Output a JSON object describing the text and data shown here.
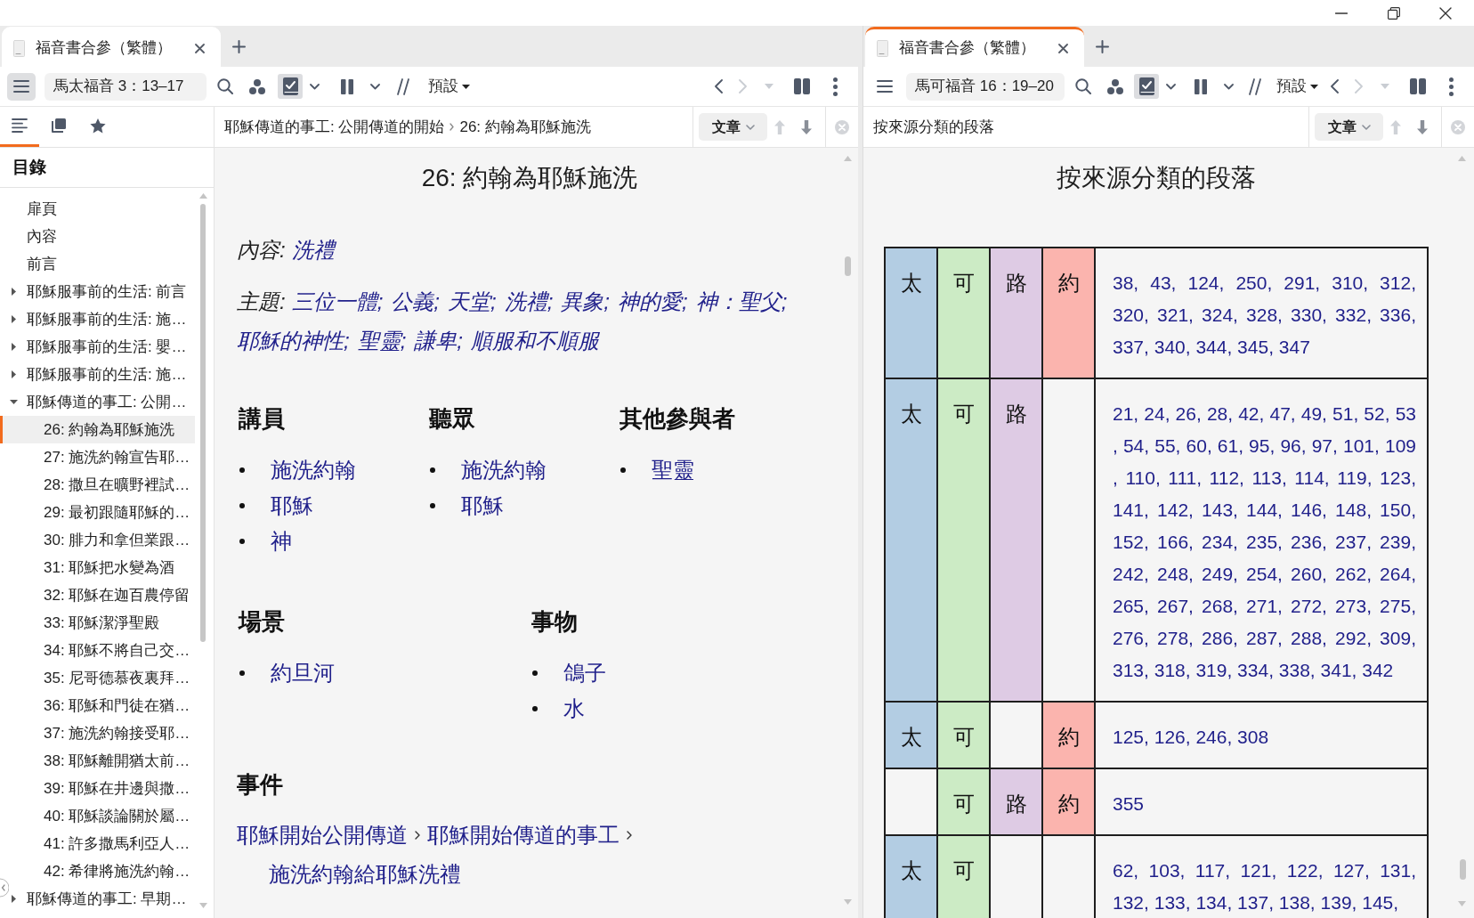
{
  "left_pane": {
    "focused": false,
    "tabs": [
      {
        "label": "福音書合參（繁體）",
        "selected": true
      }
    ],
    "toolbar": {
      "menu_pressed": true,
      "reference": "馬太福音 3：13–17",
      "markers_on": true,
      "preset": "預設",
      "back_disabled": false,
      "forward_disabled": true,
      "history_disabled": true
    },
    "sidebar": {
      "tabs": [
        {
          "selected": true
        },
        {
          "selected": false
        },
        {
          "selected": false
        }
      ],
      "title": "目錄",
      "items": [
        {
          "kind": "page",
          "label": "扉頁",
          "selected": false
        },
        {
          "kind": "page",
          "label": "內容",
          "selected": false
        },
        {
          "kind": "page",
          "label": "前言",
          "selected": false
        },
        {
          "kind": "section",
          "label": "耶穌服事前的生活: 前言",
          "expanded": false,
          "selected": false
        },
        {
          "kind": "section",
          "label": "耶穌服事前的生活: 施…",
          "expanded": false,
          "selected": false
        },
        {
          "kind": "section",
          "label": "耶穌服事前的生活: 嬰…",
          "expanded": false,
          "selected": false
        },
        {
          "kind": "section",
          "label": "耶穌服事前的生活: 施…",
          "expanded": false,
          "selected": false
        },
        {
          "kind": "section",
          "label": "耶穌傳道的事工: 公開…",
          "expanded": true,
          "selected": false,
          "children": [
            {
              "kind": "page",
              "label": "26: 約翰為耶穌施洗",
              "selected": true
            },
            {
              "kind": "page",
              "label": "27: 施洗約翰宣告耶…",
              "selected": false
            },
            {
              "kind": "page",
              "label": "28: 撒旦在曠野裡試…",
              "selected": false
            },
            {
              "kind": "page",
              "label": "29: 最初跟隨耶穌的…",
              "selected": false
            },
            {
              "kind": "page",
              "label": "30: 腓力和拿但業跟…",
              "selected": false
            },
            {
              "kind": "page",
              "label": "31: 耶穌把水變為酒",
              "selected": false
            },
            {
              "kind": "page",
              "label": "32: 耶穌在迦百農停留",
              "selected": false
            },
            {
              "kind": "page",
              "label": "33: 耶穌潔淨聖殿",
              "selected": false
            },
            {
              "kind": "page",
              "label": "34: 耶穌不將自己交…",
              "selected": false
            },
            {
              "kind": "page",
              "label": "35: 尼哥德慕夜裏拜…",
              "selected": false
            },
            {
              "kind": "page",
              "label": "36: 耶穌和門徒在猶…",
              "selected": false
            },
            {
              "kind": "page",
              "label": "37: 施洗約翰接受耶…",
              "selected": false
            },
            {
              "kind": "page",
              "label": "38: 耶穌離開猶太前…",
              "selected": false
            },
            {
              "kind": "page",
              "label": "39: 耶穌在井邊與撒…",
              "selected": false
            },
            {
              "kind": "page",
              "label": "40: 耶穌談論關於屬…",
              "selected": false
            },
            {
              "kind": "page",
              "label": "41: 許多撒馬利亞人…",
              "selected": false
            },
            {
              "kind": "page",
              "label": "42: 希律將施洗約翰…",
              "selected": false
            }
          ]
        },
        {
          "kind": "section",
          "label": "耶穌傳道的事工: 早期…",
          "expanded": false,
          "selected": false
        }
      ]
    },
    "header": {
      "breadcrumb": [
        "耶穌傳道的事工: 公開傳道的開始",
        "26: 約翰為耶穌施洗"
      ],
      "view_button": "文章",
      "up_disabled": true,
      "down_disabled": false
    },
    "article": {
      "title": "26: 約翰為耶穌施洗",
      "content": {
        "label": "內容:",
        "links": [
          "洗禮"
        ]
      },
      "topics": {
        "label": "主題:",
        "separator": ";",
        "links": [
          "三位一體",
          "公義",
          "天堂",
          "洗禮",
          "異象",
          "神的愛",
          "神：聖父",
          "耶穌的神性",
          "聖靈",
          "謙卑",
          "順服和不順服"
        ]
      },
      "participant_groups": [
        {
          "heading": "講員",
          "items": [
            "施洗約翰",
            "耶穌",
            "神"
          ]
        },
        {
          "heading": "聽眾",
          "items": [
            "施洗約翰",
            "耶穌"
          ]
        },
        {
          "heading": "其他參與者",
          "items": [
            "聖靈"
          ]
        }
      ],
      "setting_groups": [
        {
          "heading": "場景",
          "items": [
            "約旦河"
          ]
        },
        {
          "heading": "事物",
          "items": [
            "鴿子",
            "水"
          ]
        }
      ],
      "events": {
        "heading": "事件",
        "path": [
          "耶穌開始公開傳道",
          "耶穌開始傳道的事工",
          "施洗約翰給耶穌洗禮"
        ]
      }
    }
  },
  "right_pane": {
    "focused": true,
    "tabs": [
      {
        "label": "福音書合參（繁體）",
        "selected": true
      }
    ],
    "toolbar": {
      "menu_pressed": false,
      "reference": "馬可福音 16：19–20",
      "markers_on": true,
      "preset": "預設",
      "back_disabled": false,
      "forward_disabled": true,
      "history_disabled": true
    },
    "header": {
      "title": "按來源分類的段落",
      "view_button": "文章",
      "up_disabled": true,
      "down_disabled": false
    },
    "article": {
      "title": "按來源分類的段落",
      "rows": [
        {
          "gospels": [
            {
              "kind": "marked",
              "label": "太",
              "color": "#b3cde3"
            },
            {
              "kind": "marked",
              "label": "可",
              "color": "#ccebc5"
            },
            {
              "kind": "marked",
              "label": "路",
              "color": "#decbe4"
            },
            {
              "kind": "marked",
              "label": "約",
              "color": "#fbb4ae"
            }
          ],
          "lines": [
            "38, 43, 124, 250, 291, 310, 312,",
            "320, 321, 324, 328, 330, 332, 336,",
            "337, 340, 344, 345, 347"
          ]
        },
        {
          "gospels": [
            {
              "kind": "marked",
              "label": "太",
              "color": "#b3cde3"
            },
            {
              "kind": "marked",
              "label": "可",
              "color": "#ccebc5"
            },
            {
              "kind": "marked",
              "label": "路",
              "color": "#decbe4"
            },
            {
              "kind": "blank"
            }
          ],
          "lines": [
            "21, 24, 26, 28, 42, 47, 49, 51, 52, 53",
            ", 54, 55, 60, 61, 95, 96, 97, 101, 109",
            ", 110, 111, 112, 113, 114, 119, 123,",
            "141, 142, 143, 144, 146, 148, 150,",
            "152, 166, 234, 235, 236, 237, 239,",
            "242, 248, 249, 254, 260, 262, 264,",
            "265, 267, 268, 271, 272, 273, 275,",
            "276, 278, 286, 287, 288, 292, 309,",
            "313, 318, 319, 334, 338, 341, 342"
          ]
        },
        {
          "gospels": [
            {
              "kind": "marked",
              "label": "太",
              "color": "#b3cde3"
            },
            {
              "kind": "marked",
              "label": "可",
              "color": "#ccebc5"
            },
            {
              "kind": "blank"
            },
            {
              "kind": "marked",
              "label": "約",
              "color": "#fbb4ae"
            }
          ],
          "lines": [
            "125, 126, 246, 308"
          ]
        },
        {
          "gospels": [
            {
              "kind": "blank"
            },
            {
              "kind": "marked",
              "label": "可",
              "color": "#ccebc5"
            },
            {
              "kind": "marked",
              "label": "路",
              "color": "#decbe4"
            },
            {
              "kind": "marked",
              "label": "約",
              "color": "#fbb4ae"
            }
          ],
          "lines": [
            "355"
          ]
        },
        {
          "gospels": [
            {
              "kind": "marked",
              "label": "太",
              "color": "#b3cde3"
            },
            {
              "kind": "marked",
              "label": "可",
              "color": "#ccebc5"
            },
            {
              "kind": "blank"
            },
            {
              "kind": "blank"
            }
          ],
          "lines": [
            "62, 103, 117, 121, 122, 127, 131,",
            "132, 133, 134, 137, 138, 139, 145,"
          ]
        }
      ]
    }
  }
}
